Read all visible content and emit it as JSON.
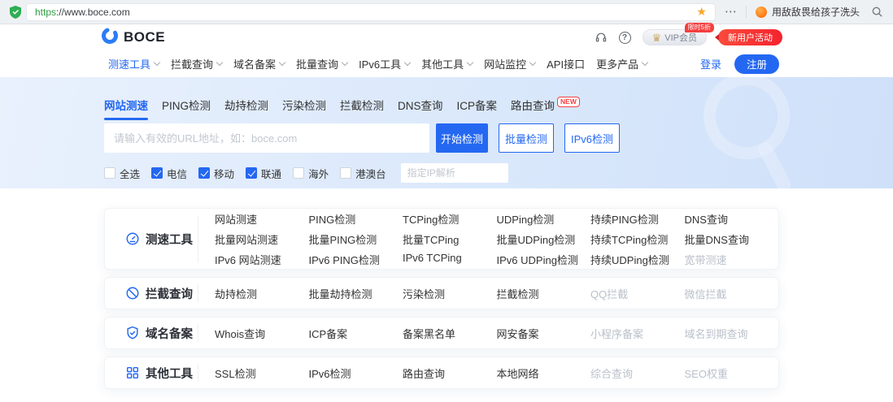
{
  "browser": {
    "url_scheme": "https",
    "url_rest": "://www.boce.com",
    "hot_search": "用敌敌畏给孩子洗头"
  },
  "icons": {
    "star": "★",
    "more": "⋯",
    "question": "?",
    "crown": "♛"
  },
  "header": {
    "logo": "BOCE",
    "vip_label": "VIP会员",
    "vip_tag": "限时5折",
    "activity_label": "新用户活动"
  },
  "nav": {
    "items": [
      {
        "label": "测速工具",
        "dropdown": true,
        "active": true
      },
      {
        "label": "拦截查询",
        "dropdown": true
      },
      {
        "label": "域名备案",
        "dropdown": true
      },
      {
        "label": "批量查询",
        "dropdown": true
      },
      {
        "label": "IPv6工具",
        "dropdown": true
      },
      {
        "label": "其他工具",
        "dropdown": true
      },
      {
        "label": "网站监控",
        "dropdown": true
      },
      {
        "label": "API接口",
        "dropdown": false
      },
      {
        "label": "更多产品",
        "dropdown": true
      }
    ],
    "login": "登录",
    "register": "注册"
  },
  "hero": {
    "tabs": [
      {
        "label": "网站测速",
        "active": true
      },
      {
        "label": "PING检测"
      },
      {
        "label": "劫持检测"
      },
      {
        "label": "污染检测"
      },
      {
        "label": "拦截检测"
      },
      {
        "label": "DNS查询"
      },
      {
        "label": "ICP备案"
      },
      {
        "label": "路由查询",
        "badge": "NEW"
      }
    ],
    "input_placeholder": "请输入有效的URL地址，如：boce.com",
    "start_button": "开始检测",
    "batch_button": "批量检测",
    "ipv6_button": "IPv6检测",
    "checkboxes": [
      {
        "label": "全选",
        "checked": false
      },
      {
        "label": "电信",
        "checked": true
      },
      {
        "label": "移动",
        "checked": true
      },
      {
        "label": "联通",
        "checked": true
      },
      {
        "label": "海外",
        "checked": false
      },
      {
        "label": "港澳台",
        "checked": false
      }
    ],
    "ip_placeholder": "指定IP解析"
  },
  "sections": [
    {
      "title": "测速工具",
      "icon": "speedometer-icon",
      "items": [
        {
          "label": "网站测速"
        },
        {
          "label": "PING检测"
        },
        {
          "label": "TCPing检测"
        },
        {
          "label": "UDPing检测"
        },
        {
          "label": "持续PING检测"
        },
        {
          "label": "DNS查询"
        },
        {
          "label": "批量网站测速"
        },
        {
          "label": "批量PING检测"
        },
        {
          "label": "批量TCPing"
        },
        {
          "label": "批量UDPing检测"
        },
        {
          "label": "持续TCPing检测"
        },
        {
          "label": "批量DNS查询"
        },
        {
          "label": "IPv6 网站测速"
        },
        {
          "label": "IPv6 PING检测"
        },
        {
          "label": "IPv6 TCPing"
        },
        {
          "label": "IPv6 UDPing检测"
        },
        {
          "label": "持续UDPing检测"
        },
        {
          "label": "宽带测速",
          "muted": true
        }
      ]
    },
    {
      "title": "拦截查询",
      "icon": "block-icon",
      "items": [
        {
          "label": "劫持检测"
        },
        {
          "label": "批量劫持检测"
        },
        {
          "label": "污染检测"
        },
        {
          "label": "拦截检测"
        },
        {
          "label": "QQ拦截",
          "muted": true
        },
        {
          "label": "微信拦截",
          "muted": true
        }
      ]
    },
    {
      "title": "域名备案",
      "icon": "shield-check-icon",
      "items": [
        {
          "label": "Whois查询"
        },
        {
          "label": "ICP备案"
        },
        {
          "label": "备案黑名单"
        },
        {
          "label": "网安备案"
        },
        {
          "label": "小程序备案",
          "muted": true
        },
        {
          "label": "域名到期查询",
          "muted": true
        }
      ]
    },
    {
      "title": "其他工具",
      "icon": "grid-icon",
      "items": [
        {
          "label": "SSL检测"
        },
        {
          "label": "IPv6检测"
        },
        {
          "label": "路由查询"
        },
        {
          "label": "本地网络"
        },
        {
          "label": "综合查询",
          "muted": true
        },
        {
          "label": "SEO权重",
          "muted": true
        }
      ]
    }
  ],
  "colors": {
    "accent": "#2468f2",
    "red": "#f53f3f",
    "hero_bg": "#d9e7fb"
  }
}
